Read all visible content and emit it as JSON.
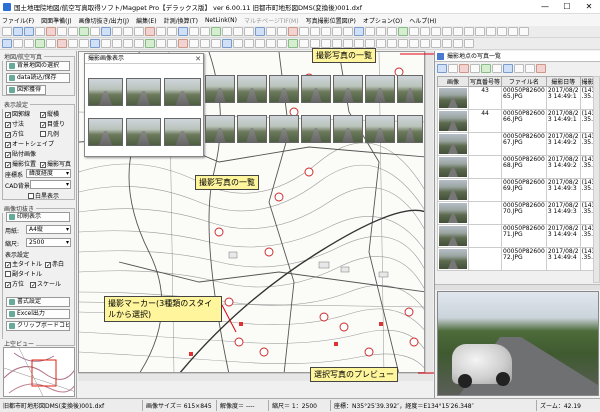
{
  "window": {
    "title": "国土地理院地図/航空写真取得ソフト/Magpet Pro【デラックス版】 ver 6.00.11  旧都市町地形図DMS(変換後)001.dxf",
    "controls": [
      "—",
      "☐",
      "✕"
    ]
  },
  "menu": [
    "ファイル(F)",
    "図面準備(J)",
    "画像切抜き/出力(J)",
    "編集(E)",
    "計測/換算(T)",
    "NetLink(N)",
    "マルチページTIF(M)",
    "写真撮影位置図(P)",
    "オプション(O)",
    "ヘルプ(H)"
  ],
  "left_panel": {
    "map_group_title": "地図/航空写真",
    "buttons": {
      "map_select": "背景地図の選択",
      "data_io": "data読込/保存",
      "paint_set": "図郭獲得"
    },
    "display_group_title": "表示設定",
    "checks": [
      {
        "label": "図郭線",
        "checked": true
      },
      {
        "label": "縦横",
        "checked": true
      },
      {
        "label": "寸法",
        "checked": true
      },
      {
        "label": "目盛り",
        "checked": true
      },
      {
        "label": "方位",
        "checked": true
      },
      {
        "label": "凡例",
        "checked": false
      },
      {
        "label": "オートシェイプ",
        "checked": true
      },
      {
        "label": "貼付画像",
        "checked": true
      },
      {
        "label": "撮影位置",
        "checked": true
      },
      {
        "label": "撮影写真",
        "checked": true
      }
    ],
    "coord_label": "座標系",
    "coord_value": "緯度経度",
    "cad_label": "CAD背景",
    "white_label": "白黒表示",
    "print_group_title": "画像切抜き",
    "print_button": "印刷表示",
    "paper_label": "用紙:",
    "paper_value": "A4縦",
    "scale_label": "縮尺:",
    "scale_value": "2500",
    "display_target_title": "表示設定",
    "targets": [
      {
        "label": "主タイトル",
        "checked": true
      },
      {
        "label": "赤白",
        "checked": true
      },
      {
        "label": "副タイトル",
        "checked": false
      },
      {
        "label": "方位",
        "checked": true
      },
      {
        "label": "スケール",
        "checked": true
      }
    ],
    "save_button": "書式設定",
    "excel_button": "Excel出力",
    "clip_button": "クリップボードコピー",
    "overview_title": "上空ビュー"
  },
  "photo_popup": {
    "title": "撮影画像表示",
    "close": "✕"
  },
  "callouts": {
    "photo_list_top": "撮影写真の一覧",
    "photo_list_map": "撮影写真の一覧",
    "marker": "撮影マーカー(3種類のスタイルから選択)",
    "preview": "選択写真のプレビュー"
  },
  "right_panel": {
    "title": "撮影地点の写真一覧",
    "columns": [
      "画像",
      "写真番号等",
      "ファイル名",
      "撮影日等",
      "撮影位置"
    ],
    "rows": [
      {
        "num": "43",
        "file": "00050P82600\n65.JPG",
        "date": "2017/08/2\n3 14:49:1",
        "pos": "(143.59\n.35.93"
      },
      {
        "num": "44",
        "file": "00050P82600\n66.JPG",
        "date": "2017/08/2\n3 14:49:1",
        "pos": "(143.59\n.35.93"
      },
      {
        "num": "",
        "file": "00050P82600\n67.JPG",
        "date": "2017/08/2\n3 14:49:2",
        "pos": "(143.59\n.35.93"
      },
      {
        "num": "",
        "file": "00050P82600\n68.JPG",
        "date": "2017/08/2\n3 14:49:2",
        "pos": "(143.59\n.35.93"
      },
      {
        "num": "",
        "file": "00050P82600\n69.JPG",
        "date": "2017/08/2\n3 14:49:3",
        "pos": "(143.59\n.35.93"
      },
      {
        "num": "",
        "file": "00050P82600\n70.JPG",
        "date": "2017/08/2\n3 14:49:3",
        "pos": "(143.59\n.35.93"
      },
      {
        "num": "",
        "file": "00050P82600\n71.JPG",
        "date": "2017/08/2\n3 14:49:4",
        "pos": "(143.59\n.35.93"
      },
      {
        "num": "",
        "file": "00050P82600\n72.JPG",
        "date": "2017/08/2\n3 14:49:4",
        "pos": "(143.59\n.35.93"
      }
    ]
  },
  "status": {
    "file": "旧都市町地形図DMS(変換後)001.dxf",
    "image_size": "画像サイズ＝ 615×845",
    "resolution": "解像度＝ ----",
    "scale": "縮尺＝ 1：2500",
    "coords": "座標：N35°25′39.392″，経度＝E134°15′26.348″",
    "zoom": "ズーム：42.19"
  }
}
